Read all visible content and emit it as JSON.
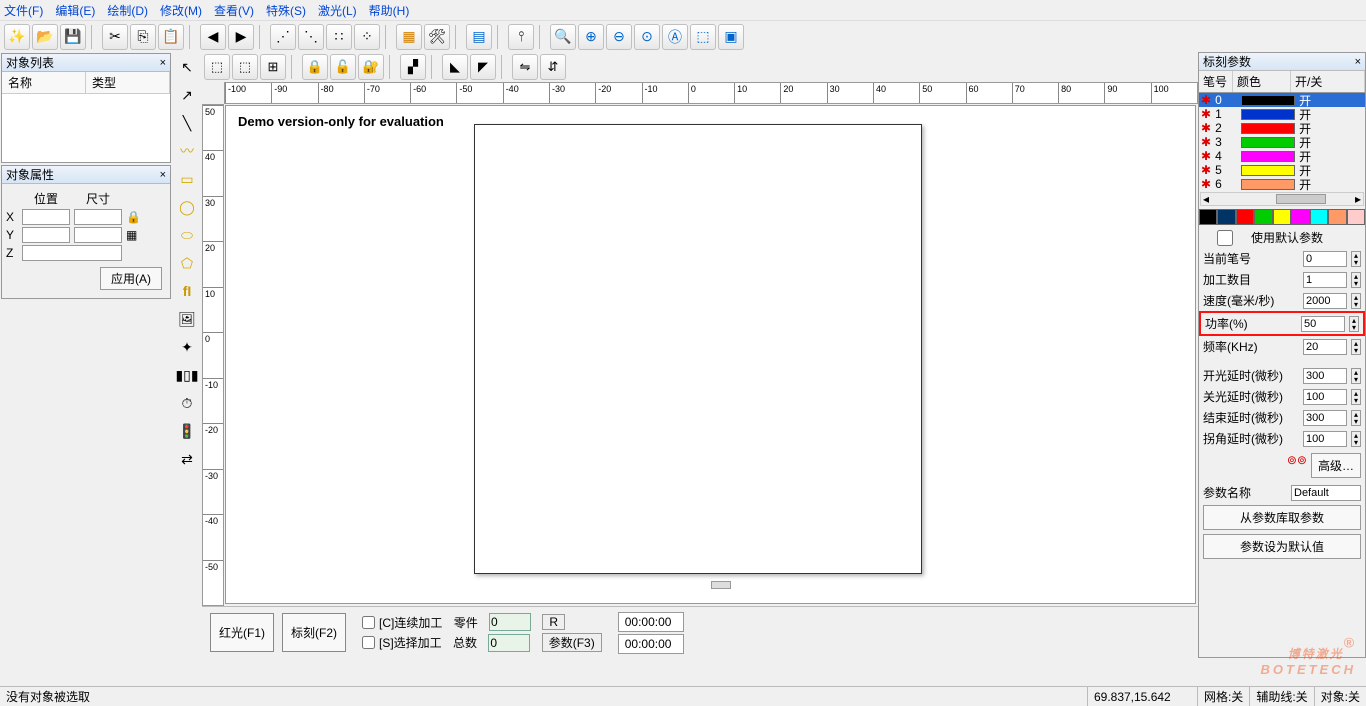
{
  "menu": [
    "文件(F)",
    "编辑(E)",
    "绘制(D)",
    "修改(M)",
    "查看(V)",
    "特殊(S)",
    "激光(L)",
    "帮助(H)"
  ],
  "panels": {
    "objlist": {
      "title": "对象列表",
      "cols": [
        "名称",
        "类型"
      ]
    },
    "objprop": {
      "title": "对象属性",
      "pos": "位置",
      "size": "尺寸",
      "axes": [
        "X",
        "Y",
        "Z"
      ],
      "apply": "应用(A)"
    }
  },
  "canvas": {
    "demo": "Demo version-only for evaluation"
  },
  "ruler_h": [
    "-100",
    "-90",
    "-80",
    "-70",
    "-60",
    "-50",
    "-40",
    "-30",
    "-20",
    "-10",
    "0",
    "10",
    "20",
    "30",
    "40",
    "50",
    "60",
    "70",
    "80",
    "90",
    "100"
  ],
  "ruler_v": [
    "50",
    "40",
    "30",
    "20",
    "10",
    "0",
    "-10",
    "-20",
    "-30",
    "-40",
    "-50"
  ],
  "bottom": {
    "red": "红光(F1)",
    "mark": "标刻(F2)",
    "cont": "[C]连续加工",
    "sel": "[S]选择加工",
    "parts": "零件",
    "total": "总数",
    "r": "R",
    "params": "参数(F3)",
    "count1": "0",
    "count2": "0",
    "t1": "00:00:00",
    "t2": "00:00:00"
  },
  "right": {
    "title": "标刻参数",
    "cols": [
      "笔号",
      "颜色",
      "开/关"
    ],
    "pens": [
      {
        "n": "0",
        "c": "#000000",
        "s": "开",
        "sel": true
      },
      {
        "n": "1",
        "c": "#0033cc",
        "s": "开"
      },
      {
        "n": "2",
        "c": "#ff0000",
        "s": "开"
      },
      {
        "n": "3",
        "c": "#00cc00",
        "s": "开"
      },
      {
        "n": "4",
        "c": "#ff00ff",
        "s": "开"
      },
      {
        "n": "5",
        "c": "#ffff00",
        "s": "开"
      },
      {
        "n": "6",
        "c": "#ff9966",
        "s": "开"
      }
    ],
    "swatches": [
      "#000",
      "#036",
      "#f00",
      "#0c0",
      "#ff0",
      "#f0f",
      "#0ff",
      "#f96",
      "#fcc"
    ],
    "useDefault": "使用默认参数",
    "params": [
      {
        "l": "当前笔号",
        "v": "0"
      },
      {
        "l": "加工数目",
        "v": "1"
      },
      {
        "l": "速度(毫米/秒)",
        "v": "2000"
      },
      {
        "l": "功率(%)",
        "v": "50",
        "hl": true
      },
      {
        "l": "频率(KHz)",
        "v": "20"
      }
    ],
    "delays": [
      {
        "l": "开光延时(微秒)",
        "v": "300"
      },
      {
        "l": "关光延时(微秒)",
        "v": "100"
      },
      {
        "l": "结束延时(微秒)",
        "v": "300"
      },
      {
        "l": "拐角延时(微秒)",
        "v": "100"
      }
    ],
    "adv": "高级…",
    "paramName": "参数名称",
    "paramVal": "Default",
    "loadLib": "从参数库取参数",
    "saveDef": "参数设为默认值"
  },
  "status": {
    "left": "没有对象被选取",
    "coord": "69.837,15.642",
    "grid": "网格:关",
    "aux": "辅助线:关",
    "obj": "对象:关"
  },
  "watermark": {
    "main": "博特激光",
    "sub": "BOTETECH",
    "r": "®"
  }
}
